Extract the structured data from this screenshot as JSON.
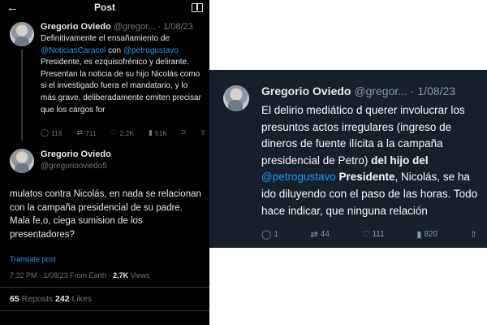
{
  "left_panel": {
    "header": {
      "title": "Post"
    },
    "post1": {
      "name": "Gregorio Oviedo",
      "handle": "@gregor...",
      "dot": "·",
      "date": "1/08/23",
      "text_1": "Definitivamente el ensañamiento de ",
      "mention_1": "@NoticiasCaracol",
      "text_2": " con ",
      "mention_2": "@petrogustavo",
      "text_3": " Presidente, es ezquisofrénico y delirante. Presentan la noticia de su hijo Nicolás como si el investigado fuera el mandatario, y lo más grave, deliberadamente omiten precisar que los cargos for",
      "actions": {
        "replies": "116",
        "reposts": "711",
        "likes": "2,2K",
        "views": "51K"
      }
    },
    "post2": {
      "name": "Gregorio Oviedo",
      "handle": "@gregoriooviedo5",
      "text": "mulatos contra Nicolás, en nada se relacionan con la campaña presidencial de su padre. Mala fe,o, ciega sumision de los presentadores?",
      "translate": "Translate post",
      "meta_time": "7:32 PM · 1/08/23 From Earth · ",
      "meta_views": "2,7K",
      "meta_views_label": " Views",
      "reposts_count": "65",
      "reposts_label": " Reposts  ",
      "likes_count": "242",
      "likes_label": " Likes"
    }
  },
  "right_panel": {
    "post": {
      "name": "Gregorio Oviedo",
      "handle": "@gregor...",
      "dot": "·",
      "date": "1/08/23",
      "text_1": "El delirio mediático d querer involucrar los presuntos actos irregulares (ingreso de dineros de fuente ilícita a la campaña presidencial de Petro) ",
      "bold_1": "del hijo del",
      "space": " ",
      "mention": "@petrogustavo",
      "bold_2": " Presidente",
      "text_2": ", Nicolás, se ha ido diluyendo con el paso de las horas. Todo hace indicar, que ninguna relación",
      "actions": {
        "replies": "1",
        "reposts": "44",
        "likes": "111",
        "views": "820"
      }
    }
  },
  "icons": {
    "back": "back-arrow-icon",
    "reader": "reader-mode-icon",
    "reply": "reply-icon",
    "repost": "repost-icon",
    "like": "like-icon",
    "views": "views-icon",
    "bookmark": "bookmark-icon",
    "share": "share-icon"
  },
  "colors": {
    "left_bg": "#000000",
    "right_bg": "#15202b",
    "link": "#1d9bf0",
    "muted": "#71767b",
    "text": "#e7e9ea"
  }
}
